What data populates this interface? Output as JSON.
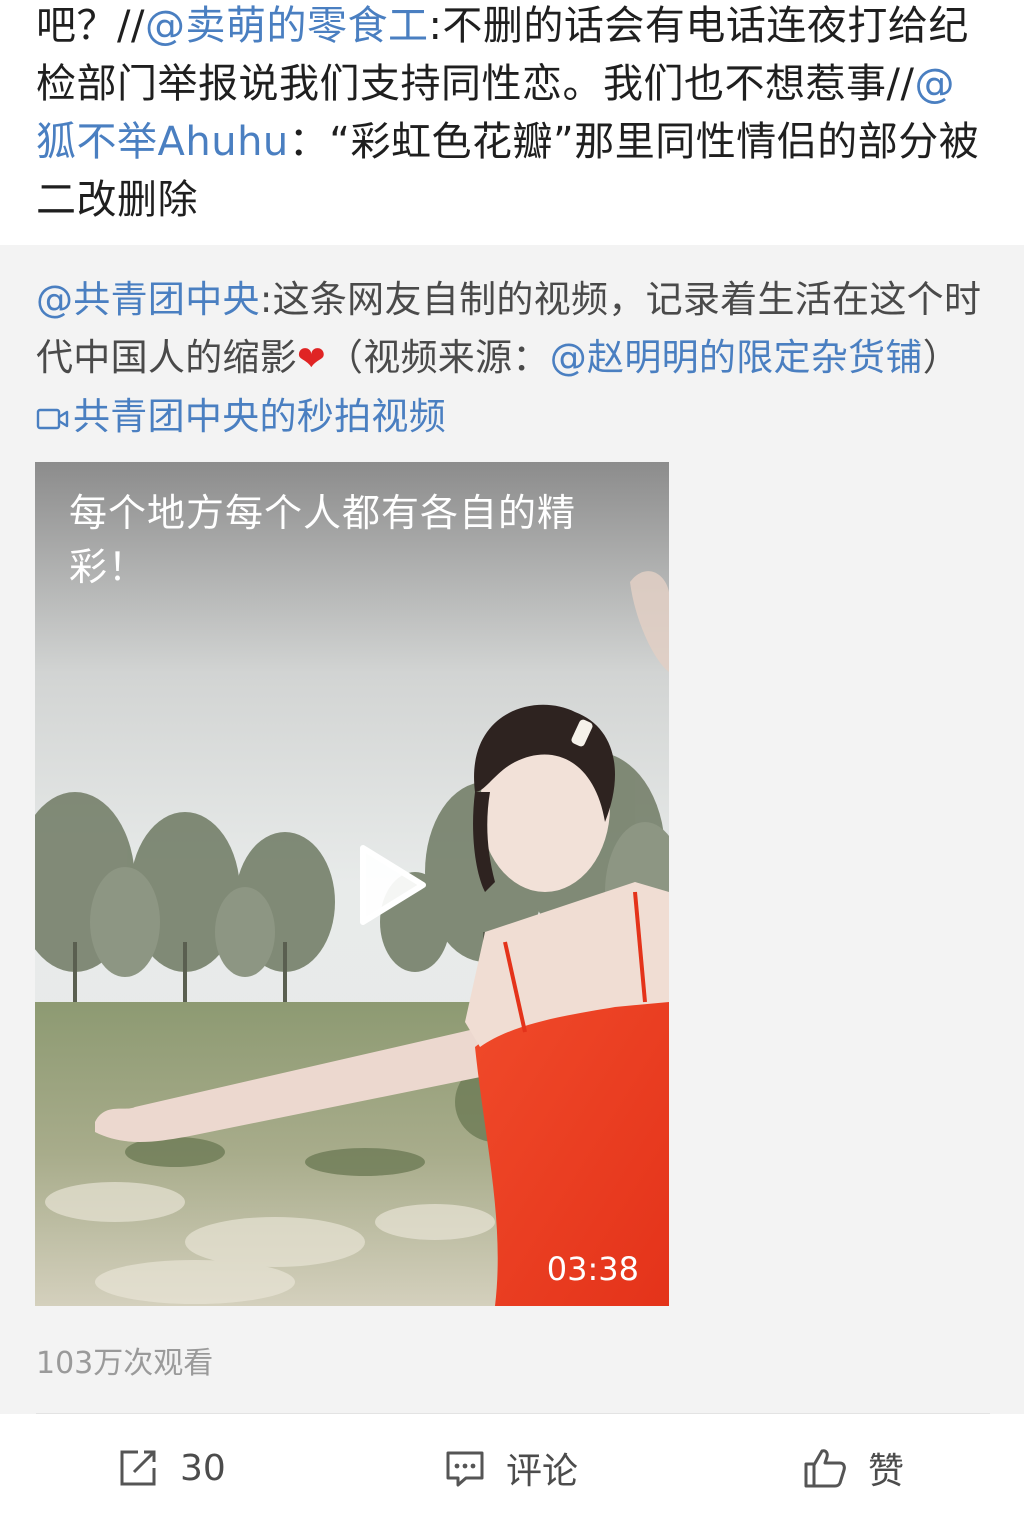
{
  "post": {
    "text_1": "吧？//",
    "mention_1": "@卖萌的零食工",
    "text_2": ":不删的话会有电话连夜打给纪检部门举报说我们支持同性恋。我们也不想惹事//",
    "mention_2": "@狐不举Ahuhu",
    "text_3": "：“彩虹色花瓣”那里同性情侣的部分被二改删除"
  },
  "repost": {
    "author": "@共青团中央",
    "text_1": ":这条网友自制的视频，记录着生活在这个时代中国人的缩影",
    "heart": "❤",
    "text_2": "（视频来源：",
    "source_mention": "@赵明明的限定杂货铺",
    "text_3": "）",
    "video_link": "共青团中央的秒拍视频",
    "video_link_icon": "video-camera-icon"
  },
  "video": {
    "caption": "每个地方每个人都有各自的精彩！",
    "duration": "03:38",
    "views": "103万次观看"
  },
  "actions": {
    "share_icon": "share-icon",
    "share_count": "30",
    "comment_icon": "comment-icon",
    "comment_label": "评论",
    "like_icon": "thumbs-up-icon",
    "like_label": "赞"
  },
  "colors": {
    "mention": "#4a7fc1",
    "repost_bg": "#f3f3f3",
    "heart": "#e02424"
  }
}
